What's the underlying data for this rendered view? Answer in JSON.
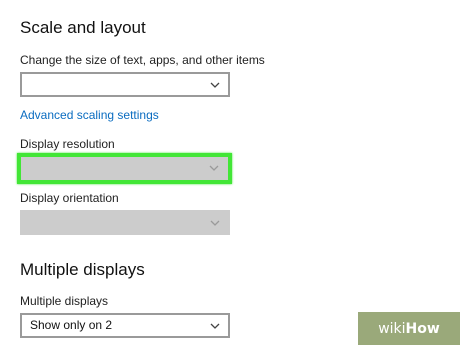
{
  "sections": {
    "scale": {
      "title": "Scale and layout",
      "size_label": "Change the size of text, apps, and other items",
      "size_value": "",
      "advanced_link": "Advanced scaling settings",
      "resolution_label": "Display resolution",
      "resolution_value": "",
      "orientation_label": "Display orientation",
      "orientation_value": ""
    },
    "multiple": {
      "title": "Multiple displays",
      "label": "Multiple displays",
      "value": "Show only on 2"
    }
  },
  "watermark": {
    "wiki": "wiki",
    "how": "How"
  },
  "colors": {
    "highlight": "#42e636",
    "link": "#0a6cc0",
    "disabled_field": "#cccccc"
  },
  "icons": [
    "chevron-down-icon"
  ]
}
